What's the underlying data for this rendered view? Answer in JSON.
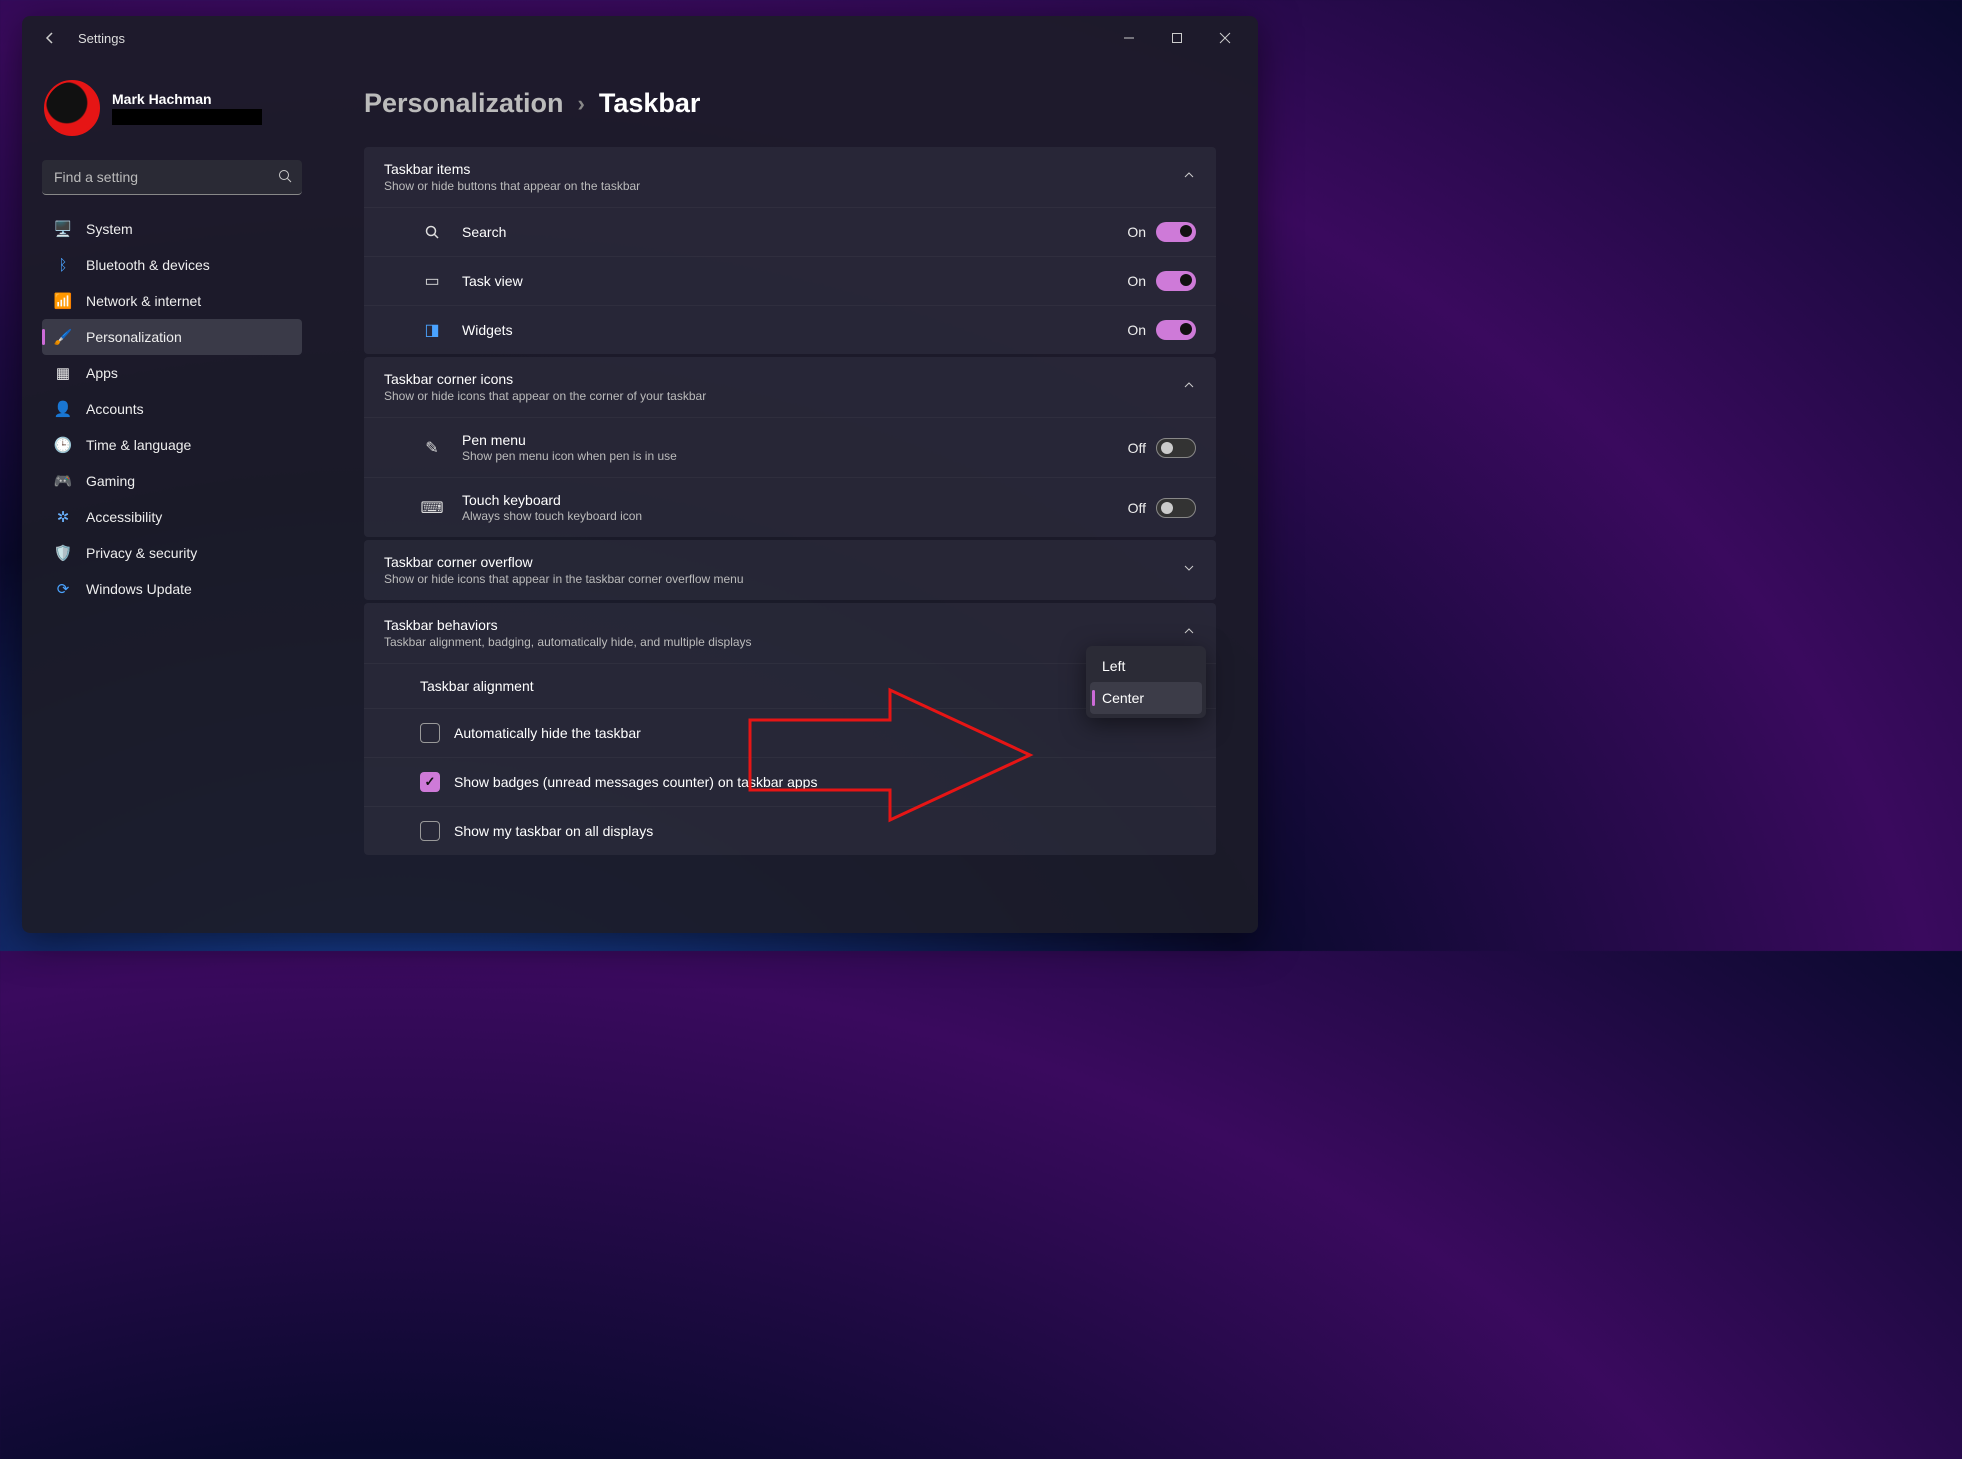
{
  "window": {
    "title": "Settings"
  },
  "profile": {
    "name": "Mark Hachman"
  },
  "search": {
    "placeholder": "Find a setting"
  },
  "nav": {
    "items": [
      {
        "label": "System"
      },
      {
        "label": "Bluetooth & devices"
      },
      {
        "label": "Network & internet"
      },
      {
        "label": "Personalization"
      },
      {
        "label": "Apps"
      },
      {
        "label": "Accounts"
      },
      {
        "label": "Time & language"
      },
      {
        "label": "Gaming"
      },
      {
        "label": "Accessibility"
      },
      {
        "label": "Privacy & security"
      },
      {
        "label": "Windows Update"
      }
    ]
  },
  "breadcrumb": {
    "parent": "Personalization",
    "current": "Taskbar"
  },
  "sections": {
    "taskbar_items": {
      "title": "Taskbar items",
      "sub": "Show or hide buttons that appear on the taskbar",
      "rows": [
        {
          "label": "Search",
          "state": "On"
        },
        {
          "label": "Task view",
          "state": "On"
        },
        {
          "label": "Widgets",
          "state": "On"
        }
      ]
    },
    "corner_icons": {
      "title": "Taskbar corner icons",
      "sub": "Show or hide icons that appear on the corner of your taskbar",
      "rows": [
        {
          "label": "Pen menu",
          "sub": "Show pen menu icon when pen is in use",
          "state": "Off"
        },
        {
          "label": "Touch keyboard",
          "sub": "Always show touch keyboard icon",
          "state": "Off"
        }
      ]
    },
    "corner_overflow": {
      "title": "Taskbar corner overflow",
      "sub": "Show or hide icons that appear in the taskbar corner overflow menu"
    },
    "behaviors": {
      "title": "Taskbar behaviors",
      "sub": "Taskbar alignment, badging, automatically hide, and multiple displays",
      "alignment_label": "Taskbar alignment",
      "alignment_options": {
        "left": "Left",
        "center": "Center"
      },
      "check1": "Automatically hide the taskbar",
      "check2": "Show badges (unread messages counter) on taskbar apps",
      "check3": "Show my taskbar on all displays"
    }
  }
}
